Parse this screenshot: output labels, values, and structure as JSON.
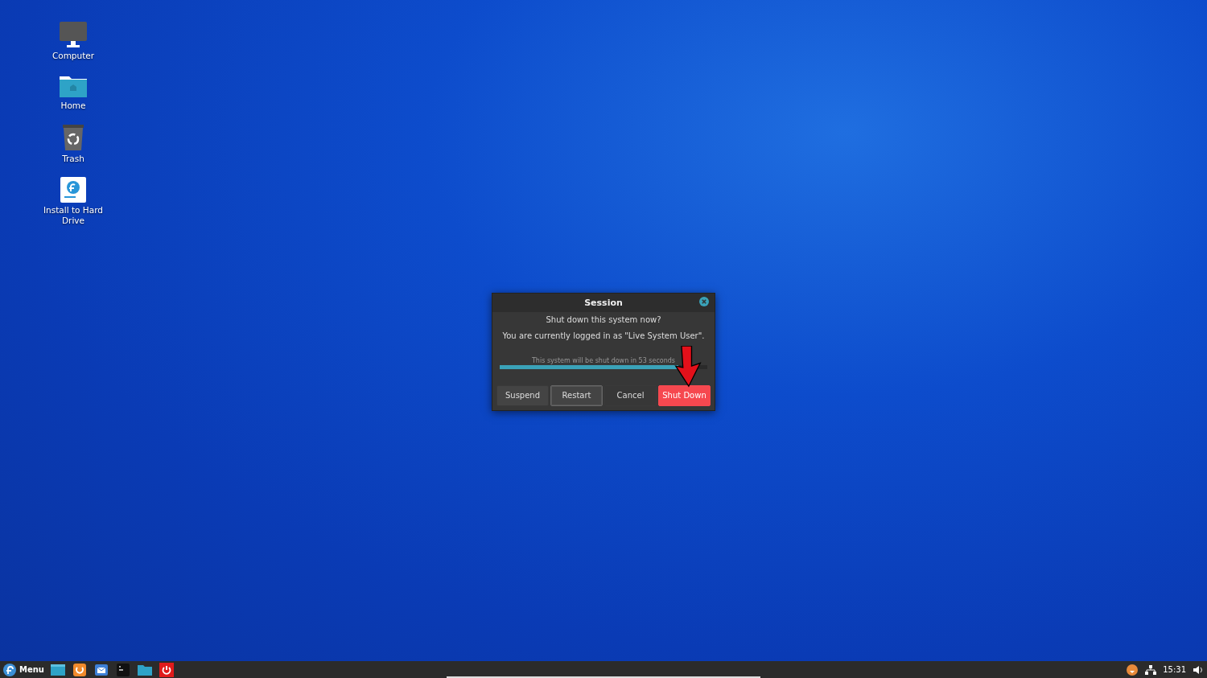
{
  "desktop_icons": [
    {
      "kind": "computer",
      "label": "Computer"
    },
    {
      "kind": "home",
      "label": "Home"
    },
    {
      "kind": "trash",
      "label": "Trash"
    },
    {
      "kind": "installer",
      "label": "Install to Hard Drive"
    }
  ],
  "dialog": {
    "title": "Session",
    "question": "Shut down this system now?",
    "message": "You are currently logged in as \"Live System User\".",
    "countdown": "This system will be shut down in 53 seconds",
    "level": 0.86,
    "buttons": [
      {
        "label": "Suspend",
        "kind": "normal",
        "focused": false
      },
      {
        "label": "Restart",
        "kind": "normal",
        "focused": true
      },
      {
        "label": "Cancel",
        "kind": "flat",
        "focused": false
      },
      {
        "label": "Shut Down",
        "kind": "danger",
        "focused": false
      }
    ]
  },
  "taskbar": {
    "menu_label": "Menu",
    "launchers": [
      {
        "kind": "window"
      },
      {
        "kind": "browser"
      },
      {
        "kind": "mail"
      },
      {
        "kind": "terminal"
      },
      {
        "kind": "folder"
      },
      {
        "kind": "power"
      }
    ],
    "clock": "15:31"
  }
}
